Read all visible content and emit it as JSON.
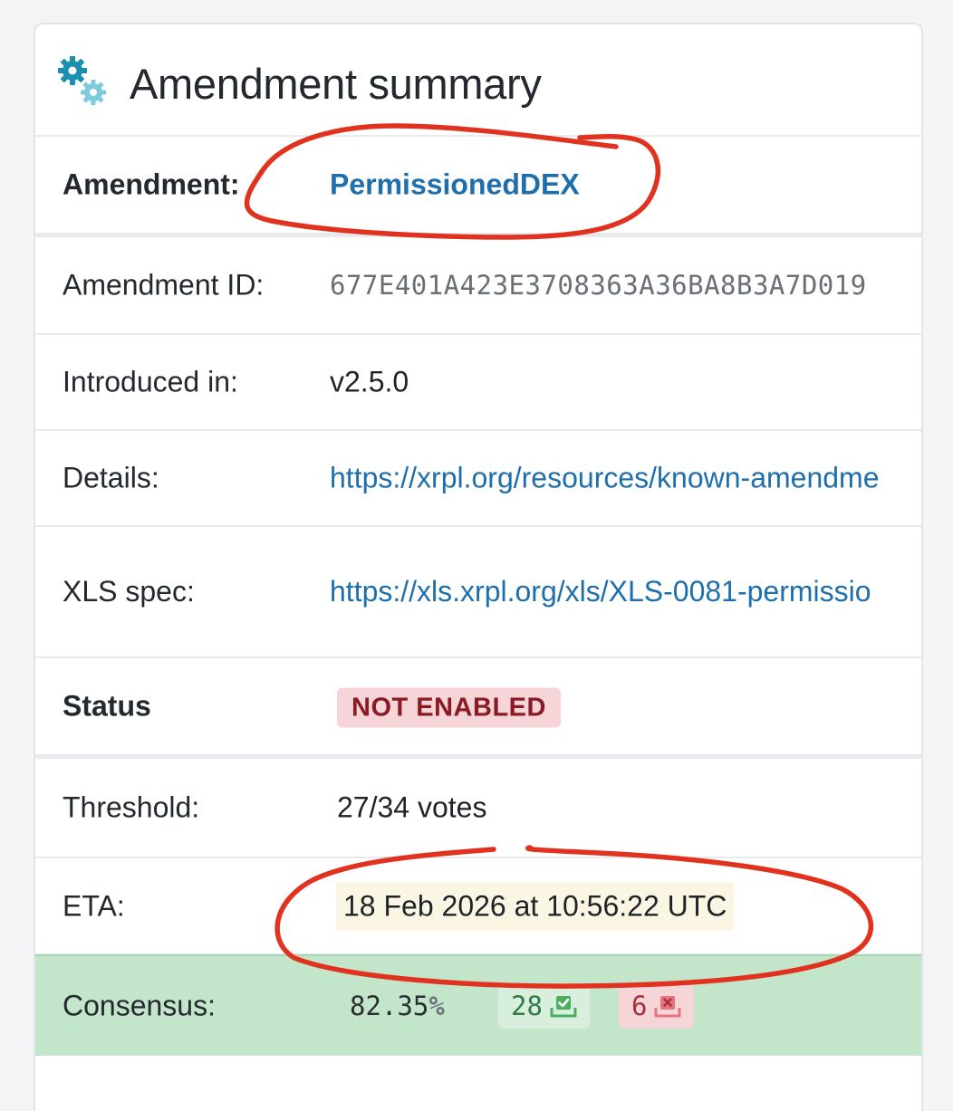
{
  "card": {
    "title": "Amendment summary",
    "icon": "gears-icon"
  },
  "rows": {
    "amendment": {
      "label": "Amendment:",
      "value": "PermissionedDEX"
    },
    "amendment_id": {
      "label": "Amendment ID:",
      "value": "677E401A423E3708363A36BA8B3A7D019"
    },
    "introduced_in": {
      "label": "Introduced in:",
      "value": "v2.5.0"
    },
    "details": {
      "label": "Details:",
      "value": "https://xrpl.org/resources/known-amendme"
    },
    "xls_spec": {
      "label": "XLS spec:",
      "value": "https://xls.xrpl.org/xls/XLS-0081-permissio"
    },
    "status": {
      "label": "Status",
      "value": "NOT ENABLED"
    },
    "threshold": {
      "label": "Threshold:",
      "value": "27/34 votes"
    },
    "eta": {
      "label": "ETA:",
      "value": "18 Feb 2026 at 10:56:22 UTC"
    },
    "consensus": {
      "label": "Consensus:",
      "percent": "82.35",
      "percent_sign": "%",
      "yes_votes": "28",
      "no_votes": "6"
    }
  },
  "colors": {
    "link": "#1f6fad",
    "status_badge_bg": "#f6d5d8",
    "status_badge_text": "#8a1a24",
    "consensus_bg": "#c3e6cb",
    "eta_highlight": "#fbf6e3",
    "annotation": "#e0321f"
  }
}
